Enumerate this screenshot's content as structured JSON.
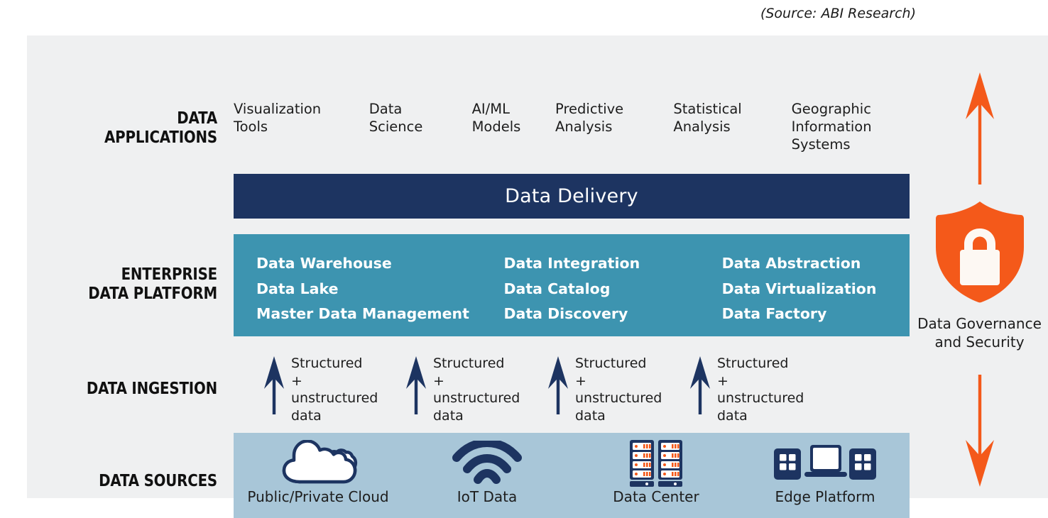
{
  "source_credit": "(Source: ABI Research)",
  "colors": {
    "panel_background": "#eff0f1",
    "navy": "#1d3461",
    "teal": "#3d94b0",
    "light_blue": "#a8c6d8",
    "orange": "#f4591a",
    "white": "#ffffff"
  },
  "rows": {
    "applications": {
      "label": "DATA\nAPPLICATIONS",
      "label_line1": "DATA",
      "label_line2": "APPLICATIONS",
      "items": [
        {
          "line1": "Visualization",
          "line2": "Tools",
          "line3": ""
        },
        {
          "line1": "Data",
          "line2": "Science",
          "line3": ""
        },
        {
          "line1": "AI/ML",
          "line2": "Models",
          "line3": ""
        },
        {
          "line1": "Predictive",
          "line2": "Analysis",
          "line3": ""
        },
        {
          "line1": "Statistical",
          "line2": "Analysis",
          "line3": ""
        },
        {
          "line1": "Geographic",
          "line2": "Information",
          "line3": "Systems"
        }
      ]
    },
    "delivery": {
      "title": "Data Delivery"
    },
    "platform": {
      "label_line1": "ENTERPRISE",
      "label_line2": "DATA PLATFORM",
      "columns": [
        [
          "Data Warehouse",
          "Data Lake",
          "Master Data Management"
        ],
        [
          "Data Integration",
          "Data Catalog",
          "Data Discovery"
        ],
        [
          "Data Abstraction",
          "Data Virtualization",
          "Data Factory"
        ]
      ]
    },
    "ingestion": {
      "label": "DATA INGESTION",
      "items": [
        {
          "line1": "Structured +",
          "line2": "unstructured",
          "line3": "data"
        },
        {
          "line1": "Structured +",
          "line2": "unstructured",
          "line3": "data"
        },
        {
          "line1": "Structured +",
          "line2": "unstructured",
          "line3": "data"
        },
        {
          "line1": "Structured +",
          "line2": "unstructured",
          "line3": "data"
        }
      ],
      "arrow_icon": "arrow-up-icon"
    },
    "sources": {
      "label": "DATA SOURCES",
      "items": [
        {
          "label": "Public/Private Cloud",
          "icon": "cloud-icon"
        },
        {
          "label": "IoT Data",
          "icon": "wifi-icon"
        },
        {
          "label": "Data Center",
          "icon": "server-rack-icon"
        },
        {
          "label": "Edge Platform",
          "icon": "edge-devices-icon"
        }
      ]
    }
  },
  "governance": {
    "label_line1": "Data Governance",
    "label_line2": "and Security",
    "shield_icon": "shield-lock-icon",
    "arrow_up_icon": "arrow-up-icon",
    "arrow_down_icon": "arrow-down-icon"
  }
}
